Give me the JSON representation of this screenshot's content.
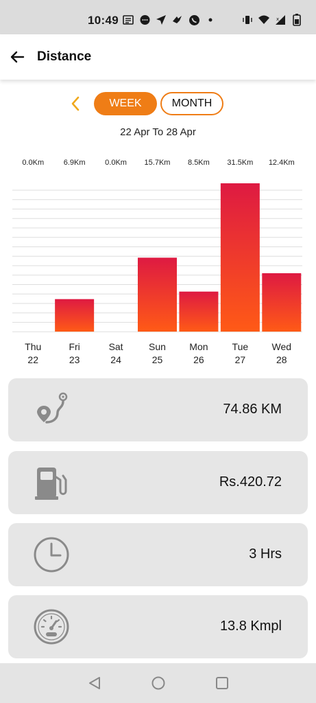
{
  "status_bar": {
    "time": "10:49",
    "left_icons": [
      "news-icon",
      "messenger-icon",
      "location-arrow-icon",
      "jio-icon",
      "whatsapp-icon",
      "dot-icon"
    ],
    "right_icons": [
      "vibrate-icon",
      "wifi-icon",
      "signal-icon",
      "battery-icon"
    ]
  },
  "app_bar": {
    "title": "Distance",
    "back_icon": "arrow-left-icon"
  },
  "period_toggle": {
    "prev_icon": "chevron-left-icon",
    "week_label": "WEEK",
    "month_label": "MONTH",
    "selected": "WEEK",
    "date_range": "22 Apr To 28 Apr"
  },
  "chart_data": {
    "type": "bar",
    "categories": [
      "Thu\n22",
      "Fri\n23",
      "Sat\n24",
      "Sun\n25",
      "Mon\n26",
      "Tue\n27",
      "Wed\n28"
    ],
    "day_labels": [
      "Thu",
      "Fri",
      "Sat",
      "Sun",
      "Mon",
      "Tue",
      "Wed"
    ],
    "date_labels": [
      "22",
      "23",
      "24",
      "25",
      "26",
      "27",
      "28"
    ],
    "values": [
      0.0,
      6.9,
      0.0,
      15.7,
      8.5,
      31.5,
      12.4
    ],
    "value_labels": [
      "0.0Km",
      "6.9Km",
      "0.0Km",
      "15.7Km",
      "8.5Km",
      "31.5Km",
      "12.4Km"
    ],
    "title": "",
    "xlabel": "",
    "ylabel": "",
    "ylim": [
      0,
      31.5
    ],
    "grid": true,
    "bar_gradient": [
      "#de1a42",
      "#ff5a16"
    ]
  },
  "stats": [
    {
      "icon": "route-pin-icon",
      "value": "74.86 KM"
    },
    {
      "icon": "fuel-pump-icon",
      "value": "Rs.420.72"
    },
    {
      "icon": "clock-icon",
      "value": "3 Hrs"
    },
    {
      "icon": "speedometer-icon",
      "value": "13.8 Kmpl"
    }
  ],
  "nav_bar": {
    "back_icon": "nav-back-icon",
    "home_icon": "nav-home-icon",
    "recents_icon": "nav-recents-icon"
  },
  "colors": {
    "accent": "#ef7d16",
    "card_bg": "#e6e6e6",
    "icon_gray": "#8a8a8a"
  }
}
